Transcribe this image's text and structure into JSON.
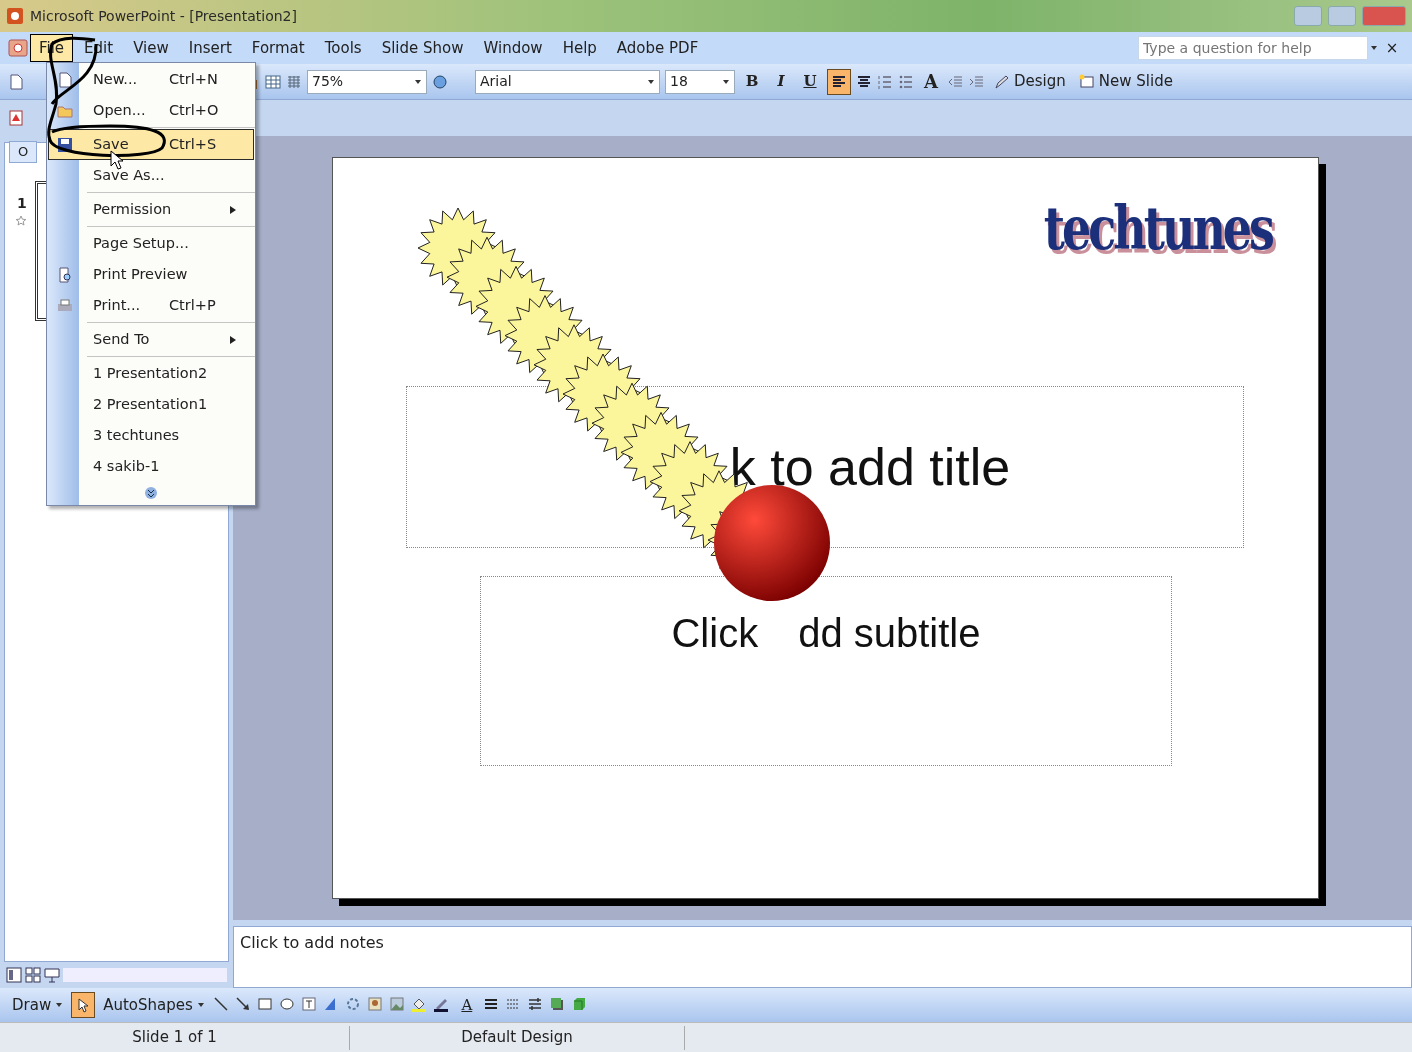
{
  "window": {
    "title": "Microsoft PowerPoint - [Presentation2]"
  },
  "menu_bar": {
    "items": [
      {
        "label": "File",
        "selected": true
      },
      {
        "label": "Edit",
        "selected": false
      },
      {
        "label": "View",
        "selected": false
      },
      {
        "label": "Insert",
        "selected": false
      },
      {
        "label": "Format",
        "selected": false
      },
      {
        "label": "Tools",
        "selected": false
      },
      {
        "label": "Slide Show",
        "selected": false
      },
      {
        "label": "Window",
        "selected": false
      },
      {
        "label": "Help",
        "selected": false
      },
      {
        "label": "Adobe PDF",
        "selected": false
      }
    ],
    "help_box": {
      "placeholder": "Type a question for help"
    },
    "close_label": "×"
  },
  "toolbar": {
    "zoom": "75%",
    "font": "Arial",
    "font_size": "18",
    "format_buttons": [
      {
        "label": "B",
        "kind": "bold",
        "on": false
      },
      {
        "label": "I",
        "kind": "italic",
        "on": false
      },
      {
        "label": "U",
        "kind": "underline",
        "on": false
      }
    ],
    "align_left_on": true,
    "grow_font": "A",
    "design": "Design",
    "new_slide": "New Slide"
  },
  "file_menu": [
    {
      "kind": "item",
      "label": "New...",
      "shortcut": "Ctrl+N",
      "selected": false
    },
    {
      "kind": "item",
      "label": "Open...",
      "shortcut": "Ctrl+O",
      "selected": false
    },
    {
      "kind": "separator"
    },
    {
      "kind": "item",
      "label": "Save",
      "shortcut": "Ctrl+S",
      "selected": true
    },
    {
      "kind": "item",
      "label": "Save As...",
      "selected": false
    },
    {
      "kind": "separator"
    },
    {
      "kind": "submenu",
      "label": "Permission",
      "selected": false
    },
    {
      "kind": "separator"
    },
    {
      "kind": "item",
      "label": "Page Setup...",
      "selected": false
    },
    {
      "kind": "item",
      "label": "Print Preview",
      "selected": false
    },
    {
      "kind": "item",
      "label": "Print...",
      "shortcut": "Ctrl+P",
      "selected": false
    },
    {
      "kind": "separator"
    },
    {
      "kind": "submenu",
      "label": "Send To",
      "selected": false
    },
    {
      "kind": "separator"
    },
    {
      "kind": "item",
      "label": "1 Presentation2",
      "selected": false
    },
    {
      "kind": "item",
      "label": "2 Presentation1",
      "selected": false
    },
    {
      "kind": "item",
      "label": "3 techtunes",
      "selected": false
    },
    {
      "kind": "item",
      "label": "4 sakib-1",
      "selected": false
    },
    {
      "kind": "expand"
    }
  ],
  "left_pane": {
    "tab": "O",
    "slide_number": "1"
  },
  "slide": {
    "logo": "techtunes",
    "title_visible": "k to add title",
    "subtitle_parts": [
      "Click",
      "dd subtitle"
    ]
  },
  "notes": {
    "text": "Click to add notes"
  },
  "drawing_toolbar": {
    "draw": "Draw",
    "autoshapes": "AutoShapes",
    "select_on": true,
    "font_color": "A"
  },
  "status_bar": [
    "Slide 1 of 1",
    "Default Design"
  ]
}
